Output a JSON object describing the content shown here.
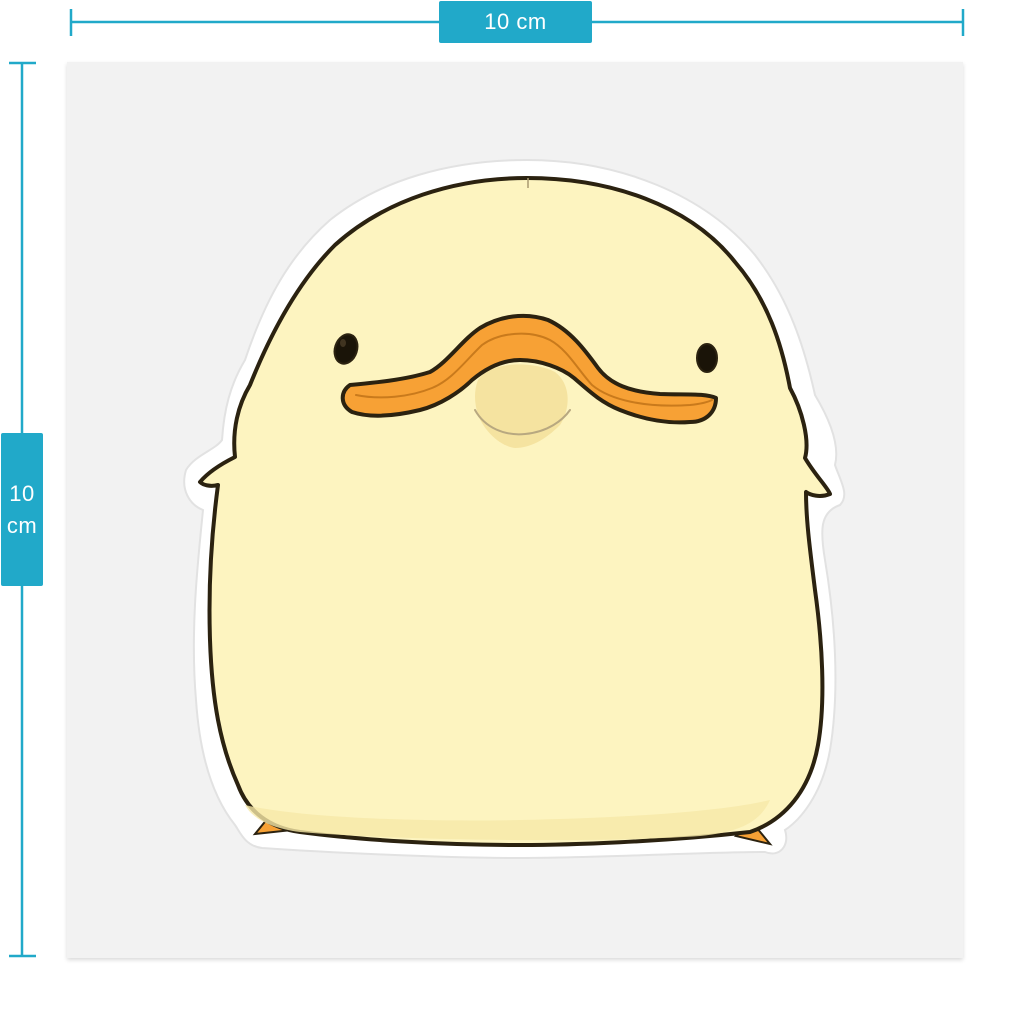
{
  "dimensions": {
    "width_label": "10 cm",
    "height_value": "10",
    "height_unit": "cm"
  },
  "colors": {
    "accent": "#21a9c9",
    "sheet": "#f2f2f2",
    "duck_body": "#fdf4c0",
    "beak": "#f7a135",
    "outline": "#2b2210"
  },
  "sticker": {
    "subject": "yellow-duck-icon"
  }
}
